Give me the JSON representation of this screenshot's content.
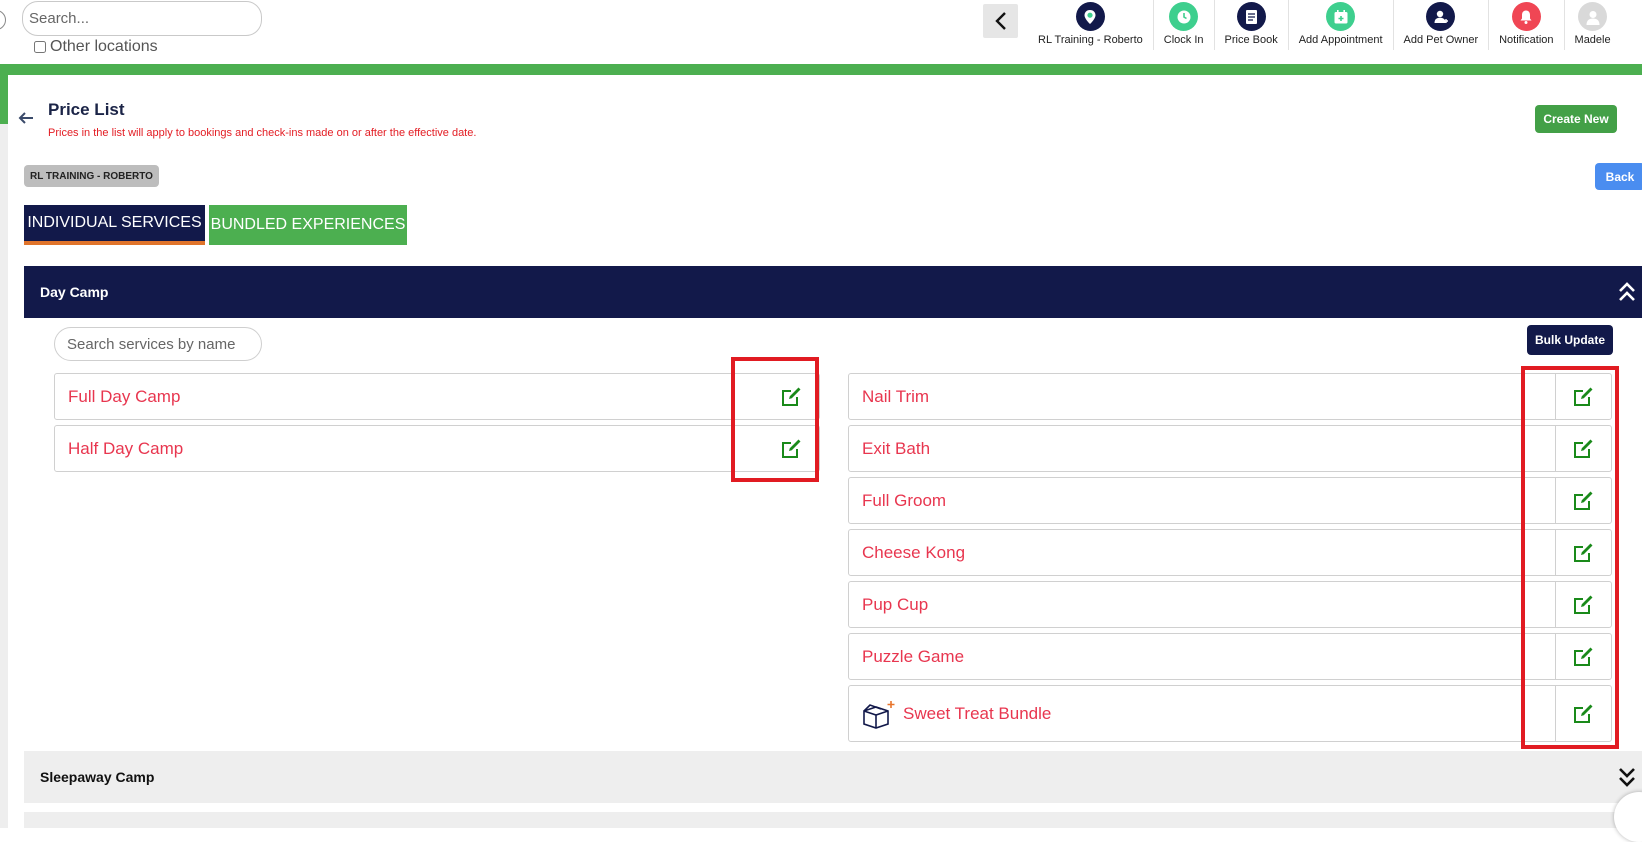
{
  "topbar": {
    "search_placeholder": "Search...",
    "other_locations_label": "Other locations",
    "nav": [
      {
        "label": "RL Training - Roberto",
        "icon": "location-pin-icon",
        "color": "#12194a"
      },
      {
        "label": "Clock In",
        "icon": "clock-icon",
        "color": "#3ecf8e"
      },
      {
        "label": "Price Book",
        "icon": "document-icon",
        "color": "#12194a"
      },
      {
        "label": "Add Appointment",
        "icon": "calendar-plus-icon",
        "color": "#3ecf8e"
      },
      {
        "label": "Add Pet Owner",
        "icon": "user-plus-icon",
        "color": "#12194a"
      },
      {
        "label": "Notification",
        "icon": "bell-icon",
        "color": "#f04654"
      },
      {
        "label": "Madele",
        "icon": "avatar-icon",
        "color": "#bdbdbd"
      }
    ]
  },
  "header": {
    "title": "Price List",
    "subtitle": "Prices in the list will apply to bookings and check-ins made on or after the effective date.",
    "create_label": "Create New",
    "location_badge": "RL TRAINING - ROBERTO",
    "back_label": "Back"
  },
  "tabs": [
    {
      "label": "INDIVIDUAL SERVICES",
      "active": true
    },
    {
      "label": "BUNDLED EXPERIENCES",
      "active": false
    }
  ],
  "day_camp": {
    "title": "Day Camp",
    "search_placeholder": "Search services by name",
    "bulk_update_label": "Bulk Update",
    "left_services": [
      "Full Day Camp",
      "Half Day Camp"
    ],
    "right_services": [
      "Nail Trim",
      "Exit Bath",
      "Full Groom",
      "Cheese Kong",
      "Pup Cup",
      "Puzzle Game",
      "Sweet Treat Bundle"
    ]
  },
  "sleepaway": {
    "title": "Sleepaway Camp"
  },
  "colors": {
    "navy": "#12194a",
    "green": "#4caf50",
    "service_text": "#e8364f",
    "edit_icon": "#1a8a1a",
    "highlight": "#e11b22"
  }
}
